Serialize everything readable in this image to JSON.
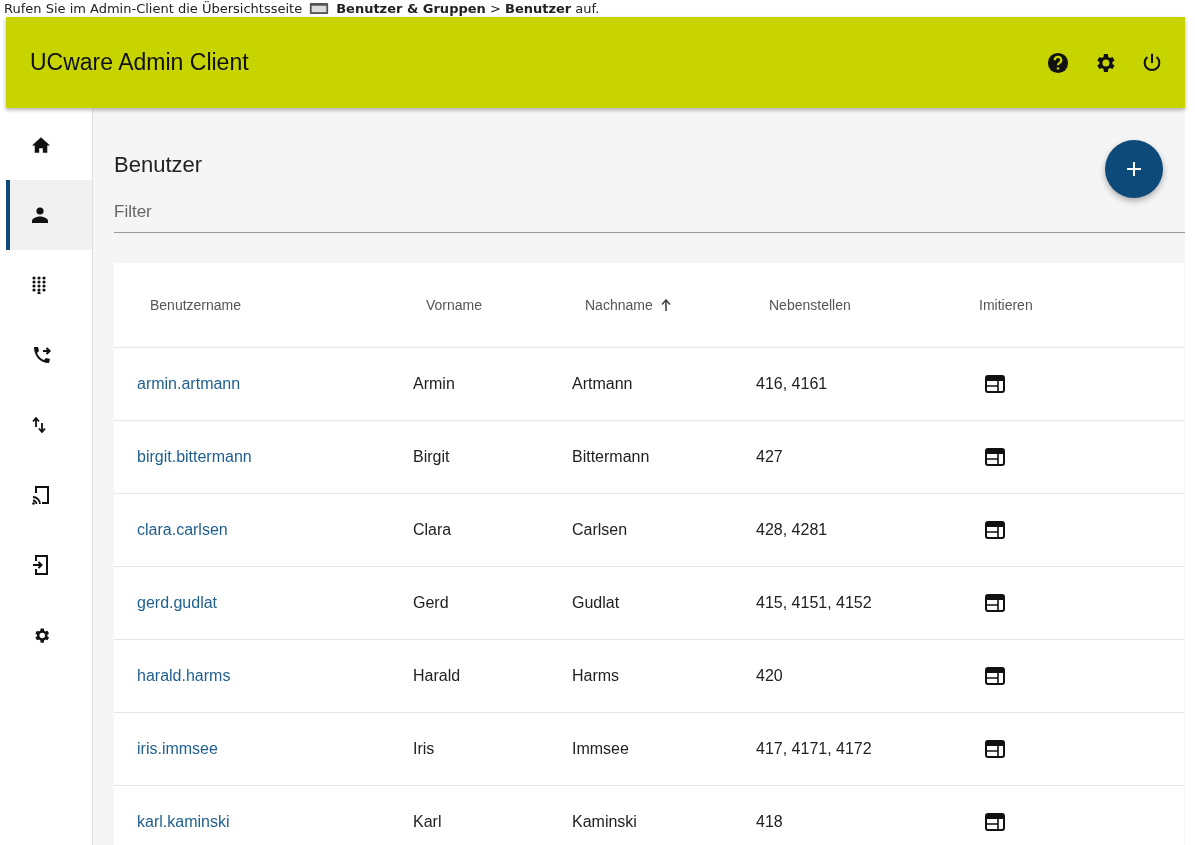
{
  "caption": {
    "before": "Rufen Sie im Admin-Client die Übersichtsseite",
    "after": "**Benutzer & Gruppen** > **Benutzer** auf."
  },
  "header": {
    "title": "UCware Admin Client"
  },
  "sidebar": {
    "items": [
      {
        "kind": "home",
        "selected": false
      },
      {
        "kind": "user",
        "selected": true
      },
      {
        "kind": "dialpad",
        "selected": false
      },
      {
        "kind": "forward",
        "selected": false
      },
      {
        "kind": "swap",
        "selected": false
      },
      {
        "kind": "cast",
        "selected": false
      },
      {
        "kind": "login",
        "selected": false
      },
      {
        "kind": "settings",
        "selected": false
      }
    ]
  },
  "page": {
    "title": "Benutzer",
    "filter_placeholder": "Filter"
  },
  "table": {
    "columns": [
      {
        "label": "Benutzername",
        "sorted": false
      },
      {
        "label": "Vorname",
        "sorted": false
      },
      {
        "label": "Nachname",
        "sorted": true
      },
      {
        "label": "Nebenstellen",
        "sorted": false
      },
      {
        "label": "Imitieren",
        "sorted": false
      }
    ],
    "rows": [
      {
        "username": "armin.artmann",
        "first": "Armin",
        "last": "Artmann",
        "ext": "416, 4161"
      },
      {
        "username": "birgit.bittermann",
        "first": "Birgit",
        "last": "Bittermann",
        "ext": "427"
      },
      {
        "username": "clara.carlsen",
        "first": "Clara",
        "last": "Carlsen",
        "ext": "428, 4281"
      },
      {
        "username": "gerd.gudlat",
        "first": "Gerd",
        "last": "Gudlat",
        "ext": "415, 4151, 4152"
      },
      {
        "username": "harald.harms",
        "first": "Harald",
        "last": "Harms",
        "ext": "420"
      },
      {
        "username": "iris.immsee",
        "first": "Iris",
        "last": "Immsee",
        "ext": "417, 4171, 4172"
      },
      {
        "username": "karl.kaminski",
        "first": "Karl",
        "last": "Kaminski",
        "ext": "418"
      }
    ]
  }
}
